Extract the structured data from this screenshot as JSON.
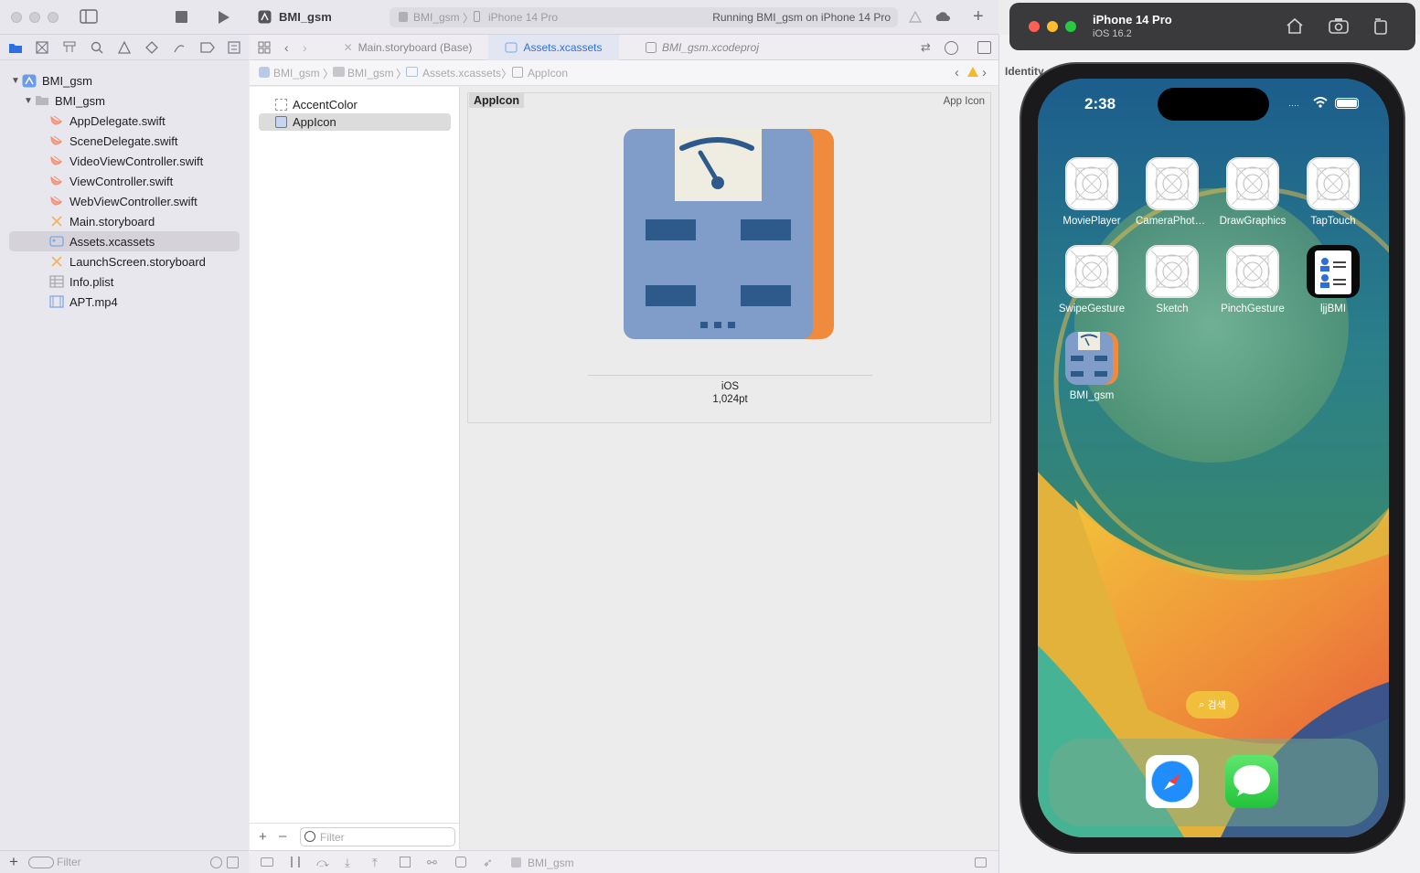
{
  "toolbar": {
    "project_name": "BMI_gsm",
    "scheme_target": "BMI_gsm",
    "scheme_device": "iPhone 14 Pro",
    "run_status": "Running BMI_gsm on iPhone 14 Pro"
  },
  "navigator": {
    "items": [
      {
        "label": "BMI_gsm",
        "kind": "project"
      },
      {
        "label": "BMI_gsm",
        "kind": "folder"
      },
      {
        "label": "AppDelegate.swift",
        "kind": "swift"
      },
      {
        "label": "SceneDelegate.swift",
        "kind": "swift"
      },
      {
        "label": "VideoViewController.swift",
        "kind": "swift"
      },
      {
        "label": "ViewController.swift",
        "kind": "swift"
      },
      {
        "label": "WebViewController.swift",
        "kind": "swift"
      },
      {
        "label": "Main.storyboard",
        "kind": "storyboard"
      },
      {
        "label": "Assets.xcassets",
        "kind": "assets",
        "selected": true
      },
      {
        "label": "LaunchScreen.storyboard",
        "kind": "storyboard"
      },
      {
        "label": "Info.plist",
        "kind": "plist"
      },
      {
        "label": "APT.mp4",
        "kind": "media"
      }
    ],
    "filter_placeholder": "Filter"
  },
  "editor_tabs": [
    {
      "label": "Main.storyboard (Base)",
      "active": false
    },
    {
      "label": "Assets.xcassets",
      "active": true
    },
    {
      "label": "BMI_gsm.xcodeproj",
      "active": false
    }
  ],
  "jumpbar": [
    "BMI_gsm",
    "BMI_gsm",
    "Assets.xcassets",
    "AppIcon"
  ],
  "assets": {
    "items": [
      {
        "label": "AccentColor",
        "selected": false
      },
      {
        "label": "AppIcon",
        "selected": true
      }
    ],
    "filter_placeholder": "Filter"
  },
  "icon_panel": {
    "title": "AppIcon",
    "kind_label": "App Icon",
    "platform": "iOS",
    "size": "1,024pt"
  },
  "status_bar": {
    "scheme": "BMI_gsm"
  },
  "inspector": {
    "label": "Identity"
  },
  "simulator": {
    "device": "iPhone 14 Pro",
    "os": "iOS 16.2",
    "time": "2:38",
    "apps": [
      {
        "label": "MoviePlayer",
        "icon": "placeholder-grid-icon"
      },
      {
        "label": "CameraPhotoL...",
        "icon": "placeholder-grid-icon"
      },
      {
        "label": "DrawGraphics",
        "icon": "placeholder-grid-icon"
      },
      {
        "label": "TapTouch",
        "icon": "placeholder-grid-icon"
      },
      {
        "label": "SwipeGesture",
        "icon": "placeholder-grid-icon"
      },
      {
        "label": "Sketch",
        "icon": "placeholder-grid-icon"
      },
      {
        "label": "PinchGesture",
        "icon": "placeholder-grid-icon"
      },
      {
        "label": "ljjBMI",
        "icon": "id-card-icon"
      },
      {
        "label": "BMI_gsm",
        "icon": "scale-icon"
      }
    ],
    "search_label": "검색",
    "dock": [
      "safari-icon",
      "messages-icon"
    ]
  }
}
